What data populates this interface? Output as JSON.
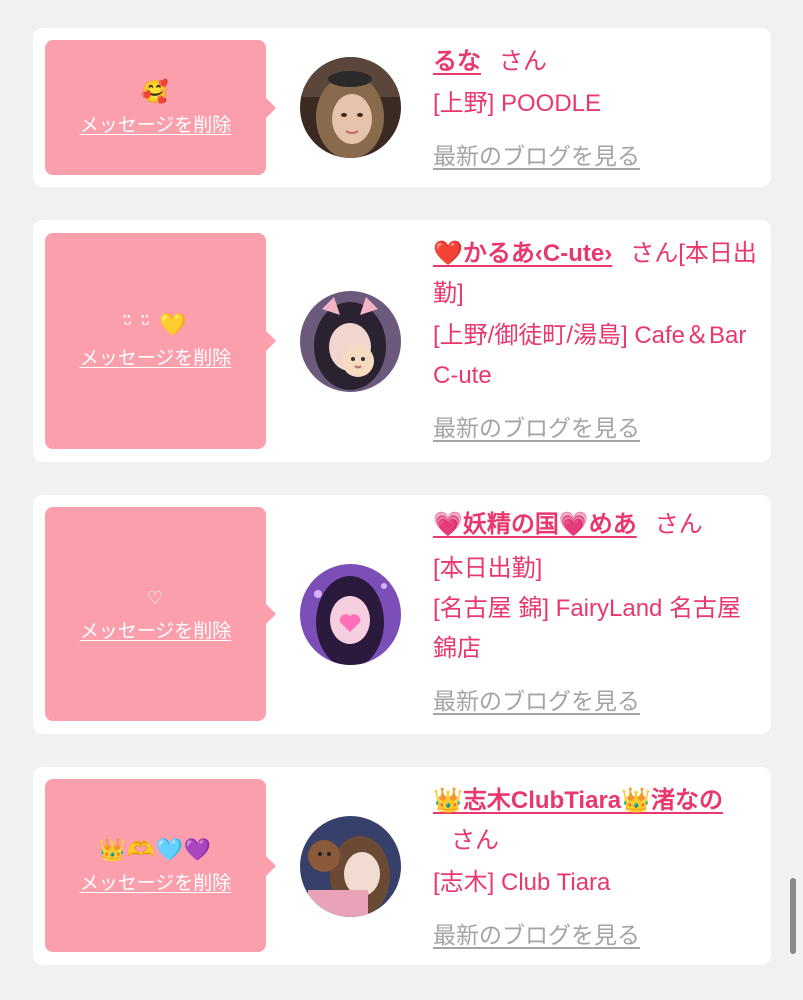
{
  "common": {
    "delete_label": "メッセージを削除",
    "blog_label": "最新のブログを見る",
    "honorific": "さん"
  },
  "cards": [
    {
      "message": "🥰",
      "name": "るな",
      "details": [
        "[上野] POODLE"
      ],
      "colors": {
        "avatar_bg": "#3b2a22",
        "hair": "#8a6a4c",
        "face": "#e6c3ab"
      }
    },
    {
      "message": "ᵕ̈ ᵕ̈ 💛",
      "name": "❤️かるあ‹C-ute›",
      "name_tail": "[本日出勤]",
      "details": [
        "[上野/御徒町/湯島] Cafe＆Bar C-ute"
      ],
      "colors": {
        "avatar_bg": "#6b5a7b",
        "hair": "#2a2230",
        "face": "#f0d6cf"
      }
    },
    {
      "message": "♡",
      "name": "💗妖精の国💗めあ",
      "details": [
        "[本日出勤]",
        "[名古屋 錦] FairyLand 名古屋錦店"
      ],
      "colors": {
        "avatar_bg": "#7c4fb8",
        "hair": "#2c1a3e",
        "face": "#f5cfe0"
      }
    },
    {
      "message": "👑🫶🩵💜",
      "name": "👑志木ClubTiara👑渚なの",
      "details": [
        "[志木] Club Tiara"
      ],
      "colors": {
        "avatar_bg": "#37406b",
        "hair": "#6b4a33",
        "face": "#f2dcd2"
      }
    }
  ],
  "accent_color": "#e8386e",
  "bubble_color": "#fb9fac"
}
